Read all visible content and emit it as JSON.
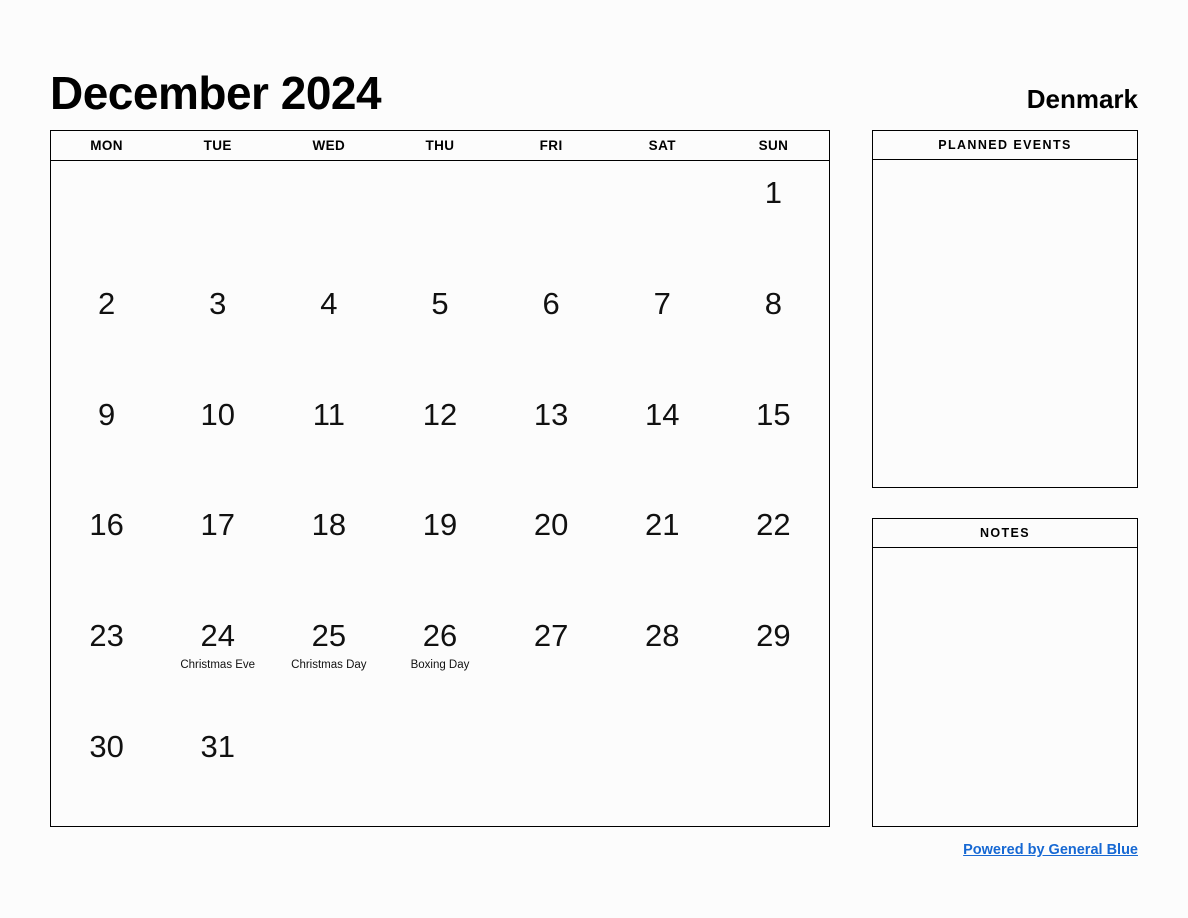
{
  "header": {
    "month_title": "December 2024",
    "region": "Denmark"
  },
  "calendar": {
    "weekdays": [
      "MON",
      "TUE",
      "WED",
      "THU",
      "FRI",
      "SAT",
      "SUN"
    ],
    "weeks": [
      [
        {
          "day": ""
        },
        {
          "day": ""
        },
        {
          "day": ""
        },
        {
          "day": ""
        },
        {
          "day": ""
        },
        {
          "day": ""
        },
        {
          "day": "1"
        }
      ],
      [
        {
          "day": "2"
        },
        {
          "day": "3"
        },
        {
          "day": "4"
        },
        {
          "day": "5"
        },
        {
          "day": "6"
        },
        {
          "day": "7"
        },
        {
          "day": "8"
        }
      ],
      [
        {
          "day": "9"
        },
        {
          "day": "10"
        },
        {
          "day": "11"
        },
        {
          "day": "12"
        },
        {
          "day": "13"
        },
        {
          "day": "14"
        },
        {
          "day": "15"
        }
      ],
      [
        {
          "day": "16"
        },
        {
          "day": "17"
        },
        {
          "day": "18"
        },
        {
          "day": "19"
        },
        {
          "day": "20"
        },
        {
          "day": "21"
        },
        {
          "day": "22"
        }
      ],
      [
        {
          "day": "23"
        },
        {
          "day": "24",
          "event": "Christmas Eve"
        },
        {
          "day": "25",
          "event": "Christmas Day"
        },
        {
          "day": "26",
          "event": "Boxing Day"
        },
        {
          "day": "27"
        },
        {
          "day": "28"
        },
        {
          "day": "29"
        }
      ],
      [
        {
          "day": "30"
        },
        {
          "day": "31"
        },
        {
          "day": ""
        },
        {
          "day": ""
        },
        {
          "day": ""
        },
        {
          "day": ""
        },
        {
          "day": ""
        }
      ]
    ]
  },
  "side_panels": {
    "planned_events_title": "PLANNED EVENTS",
    "planned_events_content": "",
    "notes_title": "NOTES",
    "notes_content": ""
  },
  "footer": {
    "link_text": "Powered by General Blue"
  },
  "colors": {
    "page_background": "#fcfcfc",
    "border": "#000000",
    "text": "#000000",
    "link": "#1668d3"
  }
}
